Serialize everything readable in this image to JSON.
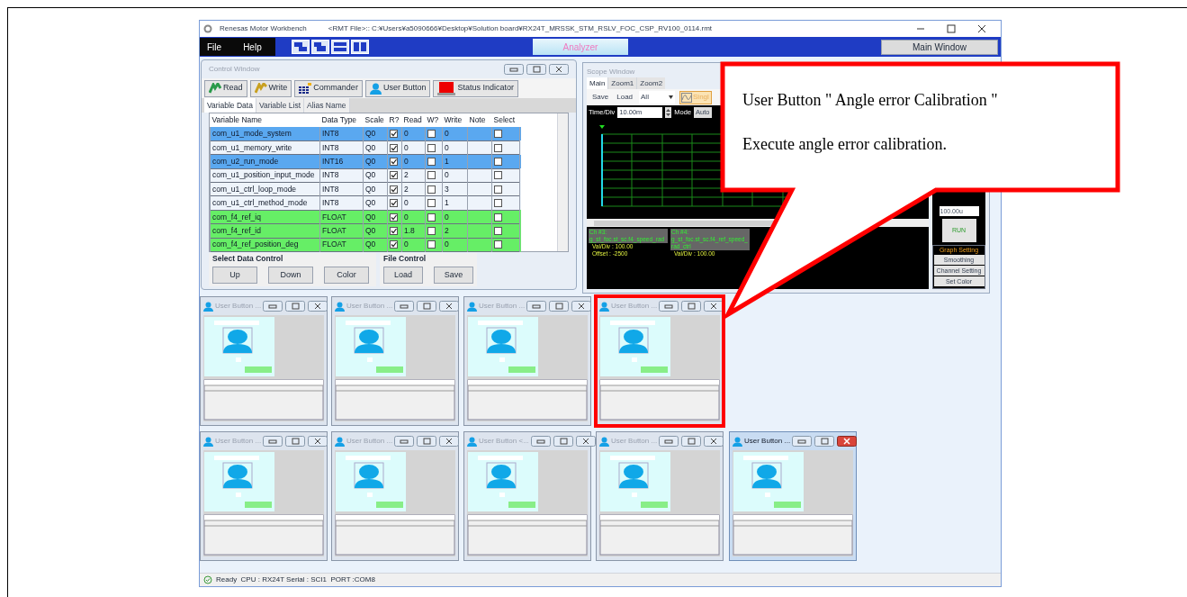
{
  "app": {
    "title": "Renesas Motor Workbench",
    "file": "<RMT File>:: C:¥Users¥a5090666¥Desktop¥Solution board¥RX24T_MRSSK_STM_RSLV_FOC_CSP_RV100_0114.rmt"
  },
  "menu": [
    "File",
    "Help"
  ],
  "analyzer_button": "Analyzer",
  "main_window_button": "Main Window",
  "control_window": {
    "title": "Control Window",
    "toolbar": [
      {
        "kind": "read",
        "label": "Read"
      },
      {
        "kind": "write",
        "label": "Write"
      },
      {
        "kind": "commander",
        "label": "Commander"
      },
      {
        "kind": "user",
        "label": "User Button"
      },
      {
        "kind": "status",
        "label": "Status Indicator"
      }
    ],
    "tabs": [
      {
        "label": "Variable Data",
        "selected": true
      },
      {
        "label": "Variable List",
        "selected": false
      },
      {
        "label": "Alias Name",
        "selected": false
      }
    ],
    "columns": [
      "Variable Name",
      "Data Type",
      "Scale",
      "R?",
      "Read",
      "W?",
      "Write",
      "Note",
      "Select"
    ],
    "rows": [
      {
        "name": "com_u1_mode_system",
        "type": "INT8",
        "scale": "Q0",
        "r": true,
        "read": "0",
        "w": false,
        "write": "0",
        "select": false,
        "color": "#5aa8f0"
      },
      {
        "name": "com_u1_memory_write",
        "type": "INT8",
        "scale": "Q0",
        "r": true,
        "read": "0",
        "w": false,
        "write": "0",
        "select": false,
        "color": "#eef4fb"
      },
      {
        "name": "com_u2_run_mode",
        "type": "INT16",
        "scale": "Q0",
        "r": true,
        "read": "0",
        "w": false,
        "write": "1",
        "select": false,
        "color": "#5aa8f0"
      },
      {
        "name": "com_u1_position_input_mode",
        "type": "INT8",
        "scale": "Q0",
        "r": true,
        "read": "2",
        "w": false,
        "write": "0",
        "select": false,
        "color": "#eef4fb"
      },
      {
        "name": "com_u1_ctrl_loop_mode",
        "type": "INT8",
        "scale": "Q0",
        "r": true,
        "read": "2",
        "w": false,
        "write": "3",
        "select": false,
        "color": "#eef4fb"
      },
      {
        "name": "com_u1_ctrl_method_mode",
        "type": "INT8",
        "scale": "Q0",
        "r": true,
        "read": "0",
        "w": false,
        "write": "1",
        "select": false,
        "color": "#eef4fb"
      },
      {
        "name": "com_f4_ref_iq",
        "type": "FLOAT",
        "scale": "Q0",
        "r": true,
        "read": "0",
        "w": false,
        "write": "0",
        "select": false,
        "color": "#66ee66"
      },
      {
        "name": "com_f4_ref_id",
        "type": "FLOAT",
        "scale": "Q0",
        "r": true,
        "read": "1.8",
        "w": false,
        "write": "2",
        "select": false,
        "color": "#66ee66"
      },
      {
        "name": "com_f4_ref_position_deg",
        "type": "FLOAT",
        "scale": "Q0",
        "r": true,
        "read": "0",
        "w": false,
        "write": "0",
        "select": false,
        "color": "#66ee66"
      }
    ],
    "select_group": {
      "title": "Select Data Control",
      "buttons": [
        "Up",
        "Down",
        "Color"
      ]
    },
    "file_group": {
      "title": "File Control",
      "buttons": [
        "Load",
        "Save"
      ]
    }
  },
  "scope_window": {
    "title": "Scope Window",
    "tabs": [
      {
        "label": "Main",
        "selected": true
      },
      {
        "label": "Zoom1",
        "selected": false
      },
      {
        "label": "Zoom2",
        "selected": false
      }
    ],
    "save": "Save",
    "load": "Load",
    "load_choice": "All",
    "single": "Singl",
    "time_div_label": "Time/Div",
    "time_div": "10.00m",
    "mode_label": "Mode",
    "mode": "Auto",
    "side_field": "100.00u",
    "run": "RUN",
    "graph_setting": {
      "title": "Graph Setting",
      "buttons": [
        "Smoothing",
        "Channel Setting",
        "Set Color"
      ]
    },
    "channels": [
      {
        "label": "Ch #3:",
        "variable": "g_st_foc.st_sc.f4_speed_rad",
        "lines": [
          "Val/Div : 100.00",
          "Offset : -2500"
        ]
      },
      {
        "label": "Ch #4:",
        "variable": "g_st_foc.st_sc.f4_ref_speed_rad_ctrl",
        "lines": [
          "Val/Div : 100.00"
        ]
      }
    ]
  },
  "user_button_windows": [
    {
      "title": "User Button ...",
      "active": false,
      "highlighted": false
    },
    {
      "title": "User Button ...",
      "active": false,
      "highlighted": false
    },
    {
      "title": "User Button ...",
      "active": false,
      "highlighted": false
    },
    {
      "title": "User Button ...",
      "active": false,
      "highlighted": true
    },
    {
      "title": "User Button ...",
      "active": false,
      "highlighted": false
    },
    {
      "title": "User Button ...",
      "active": false,
      "highlighted": false
    },
    {
      "title": "User Button <...",
      "active": false,
      "highlighted": false
    },
    {
      "title": "User Button ...",
      "active": false,
      "highlighted": false
    },
    {
      "title": "User Button ...",
      "active": true,
      "highlighted": false
    }
  ],
  "callout": {
    "lines": [
      "User Button \" Angle error Calibration \"",
      "Execute angle error calibration."
    ]
  },
  "status_bar": {
    "text": "Ready  CPU : RX24T Serial : SCI1  PORT :COM8"
  }
}
